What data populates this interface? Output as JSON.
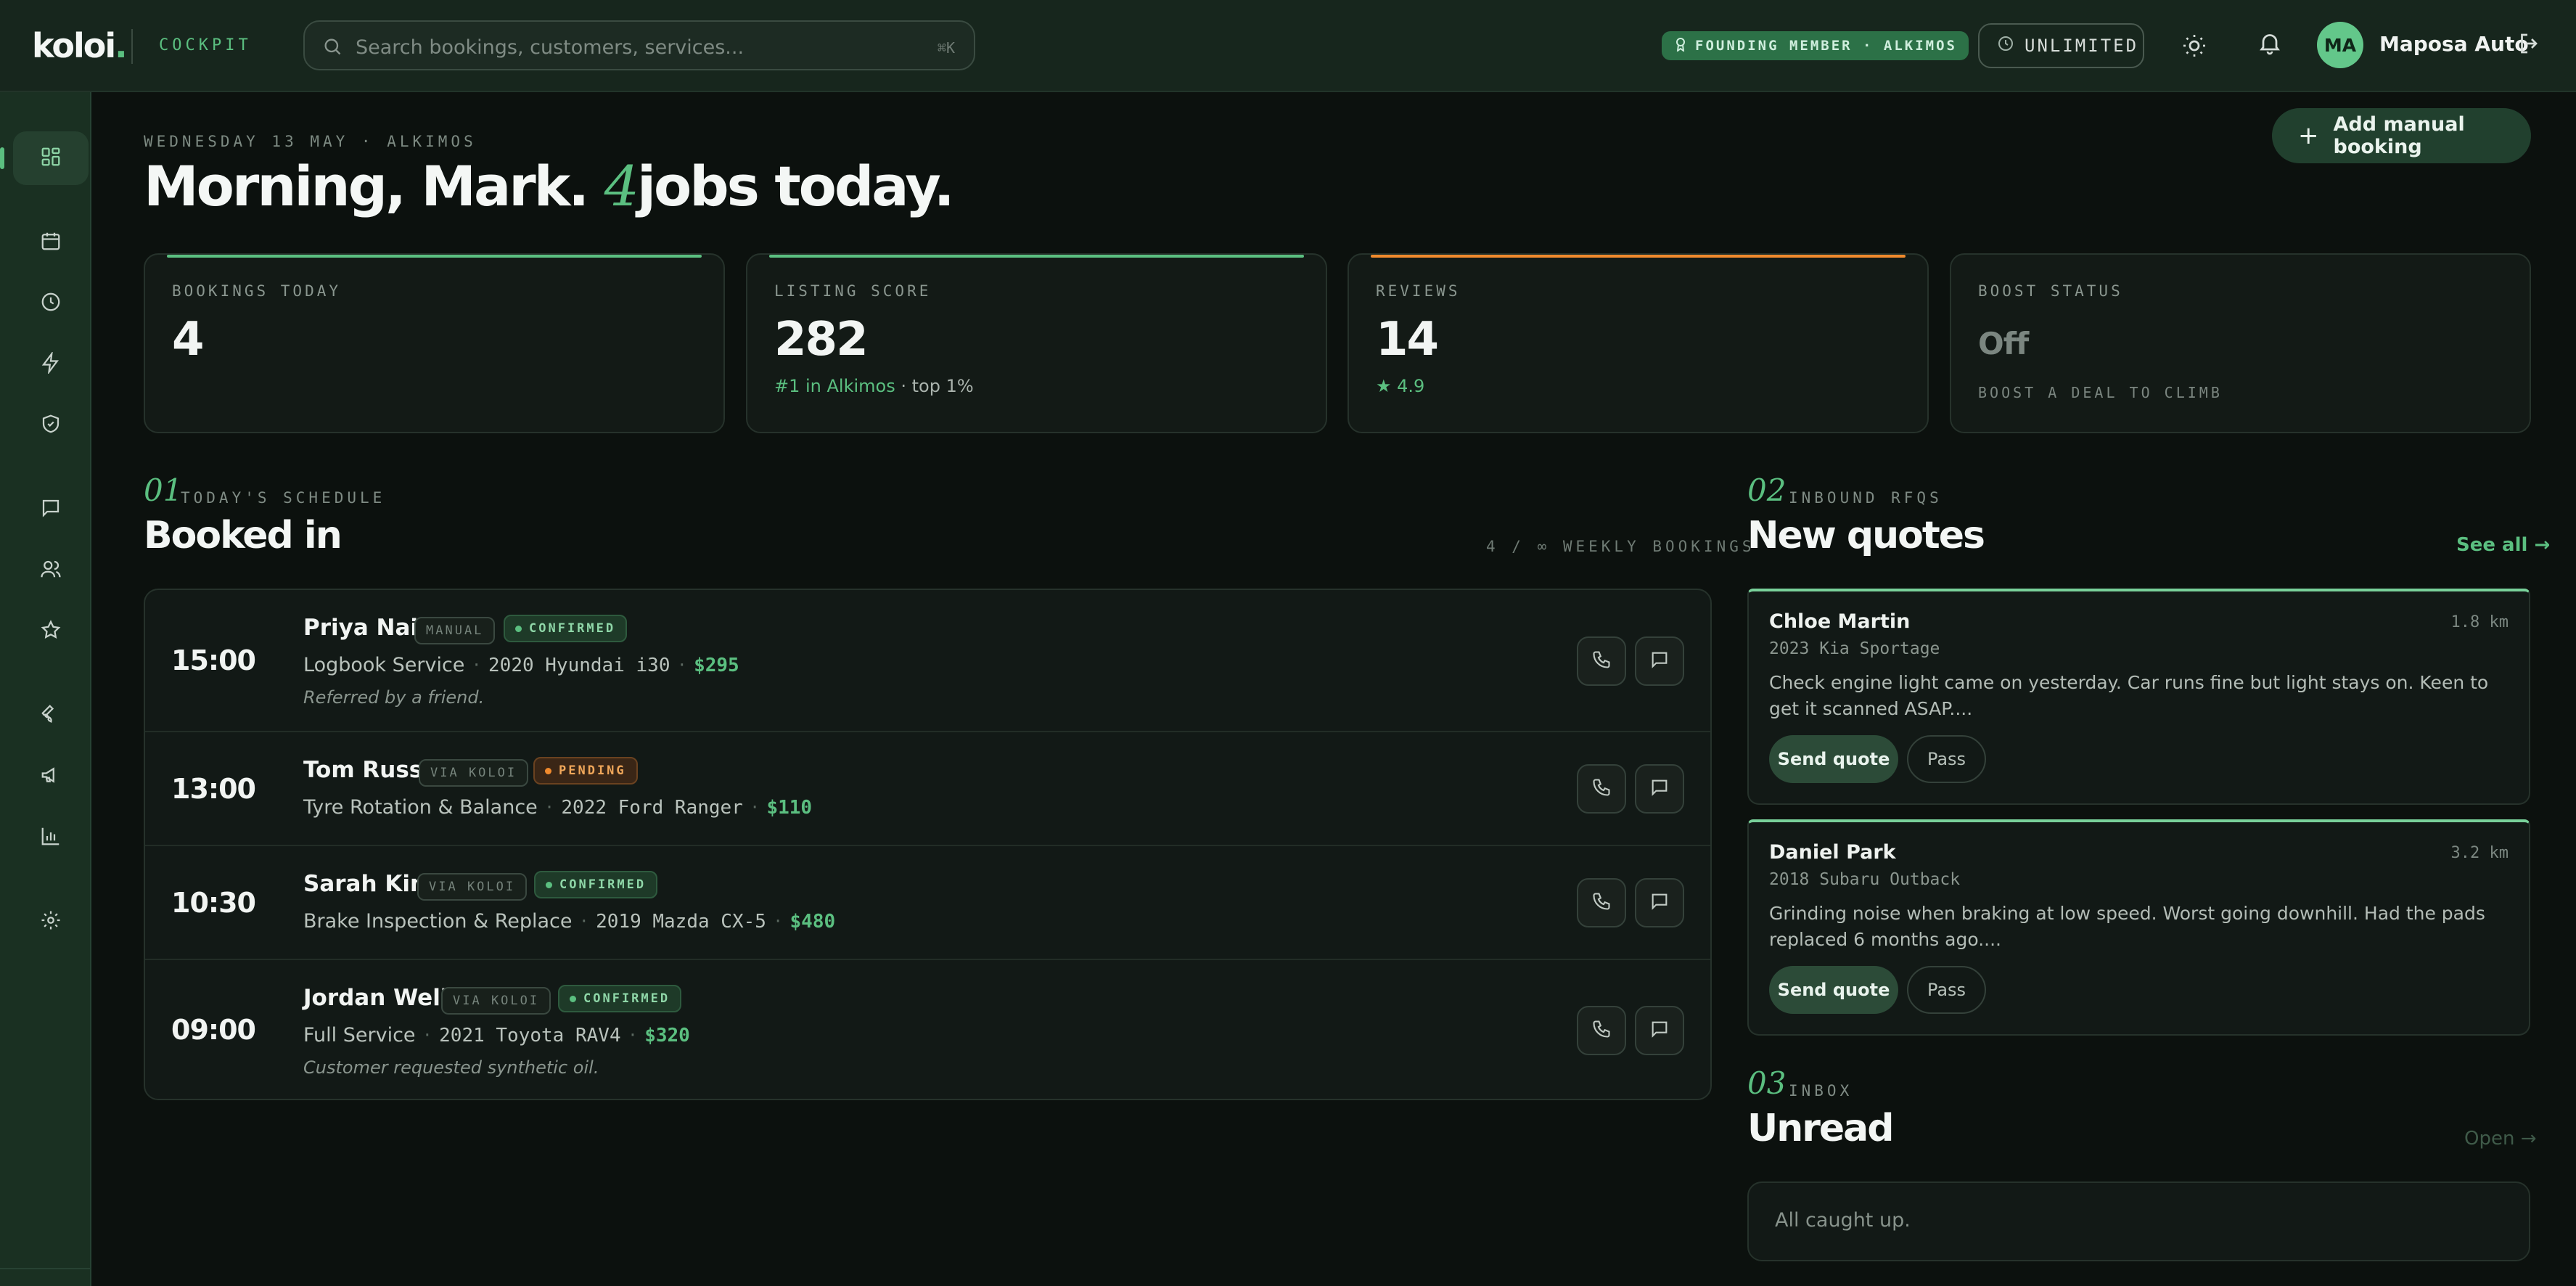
{
  "app": {
    "logo_text": "koloi",
    "logo_dot": ".",
    "section_label": "COCKPIT"
  },
  "search": {
    "placeholder": "Search bookings, customers, services...",
    "shortcut": "⌘K"
  },
  "header": {
    "founding_badge": "FOUNDING MEMBER · ALKIMOS",
    "plan_label": "UNLIMITED",
    "avatar_initials": "MA",
    "user_name": "Maposa Auto"
  },
  "sidebar": {
    "items": [
      {
        "icon": "dashboard-icon",
        "active": true
      },
      {
        "icon": "calendar-icon"
      },
      {
        "icon": "clock-icon"
      },
      {
        "icon": "lightning-icon"
      },
      {
        "icon": "shield-check-icon"
      },
      {
        "icon": "chat-icon"
      },
      {
        "icon": "users-icon"
      },
      {
        "icon": "star-icon"
      },
      {
        "icon": "wrench-icon"
      },
      {
        "icon": "megaphone-icon"
      },
      {
        "icon": "bar-chart-icon"
      },
      {
        "icon": "settings-icon"
      }
    ]
  },
  "main": {
    "dateline": "WEDNESDAY 13 MAY · ALKIMOS",
    "greeting_prefix": "Morning, Mark.",
    "greeting_count": "4",
    "greeting_suffix": "jobs today.",
    "add_button": "Add manual booking"
  },
  "stats": [
    {
      "label": "BOOKINGS TODAY",
      "value": "4",
      "accent": "#5bbf80"
    },
    {
      "label": "LISTING SCORE",
      "value": "282",
      "sub_highlight": "#1 in Alkimos",
      "sub_rest": "· top 1%",
      "accent": "#5bbf80"
    },
    {
      "label": "REVIEWS",
      "value": "14",
      "rating": "4.9",
      "accent": "#f08a2d"
    },
    {
      "label": "BOOST STATUS",
      "value": "Off",
      "hint": "BOOST A DEAL TO CLIMB"
    }
  ],
  "schedule": {
    "number": "01",
    "label": "TODAY'S SCHEDULE",
    "title": "Booked in",
    "capacity": "4 / ∞ WEEKLY BOOKINGS",
    "rows": [
      {
        "time": "15:00",
        "name": "Priya Nair",
        "source": "MANUAL",
        "status": "CONFIRMED",
        "service": "Logbook Service",
        "vehicle": "2020 Hyundai i30",
        "price": "$295",
        "note": "Referred by a friend."
      },
      {
        "time": "13:00",
        "name": "Tom Russo",
        "source": "VIA KOLOI",
        "status": "PENDING",
        "service": "Tyre Rotation & Balance",
        "vehicle": "2022 Ford Ranger",
        "price": "$110",
        "note": ""
      },
      {
        "time": "10:30",
        "name": "Sarah Kim",
        "source": "VIA KOLOI",
        "status": "CONFIRMED",
        "service": "Brake Inspection & Replace",
        "vehicle": "2019 Mazda CX-5",
        "price": "$480",
        "note": ""
      },
      {
        "time": "09:00",
        "name": "Jordan Wells",
        "source": "VIA KOLOI",
        "status": "CONFIRMED",
        "service": "Full Service",
        "vehicle": "2021 Toyota RAV4",
        "price": "$320",
        "note": "Customer requested synthetic oil."
      }
    ]
  },
  "quotes": {
    "number": "02",
    "label": "INBOUND RFQS",
    "title": "New quotes",
    "see_all": "See all →",
    "items": [
      {
        "name": "Chloe Martin",
        "distance": "1.8 km",
        "vehicle": "2023 Kia Sportage",
        "message": "Check engine light came on yesterday. Car runs fine but light stays on. Keen to get it scanned ASAP....",
        "send_label": "Send quote",
        "pass_label": "Pass"
      },
      {
        "name": "Daniel Park",
        "distance": "3.2 km",
        "vehicle": "2018 Subaru Outback",
        "message": "Grinding noise when braking at low speed. Worst going downhill. Had the pads replaced 6 months ago....",
        "send_label": "Send quote",
        "pass_label": "Pass"
      }
    ]
  },
  "inbox": {
    "number": "03",
    "label": "INBOX",
    "title": "Unread",
    "open_link": "Open →",
    "empty_text": "All caught up."
  }
}
